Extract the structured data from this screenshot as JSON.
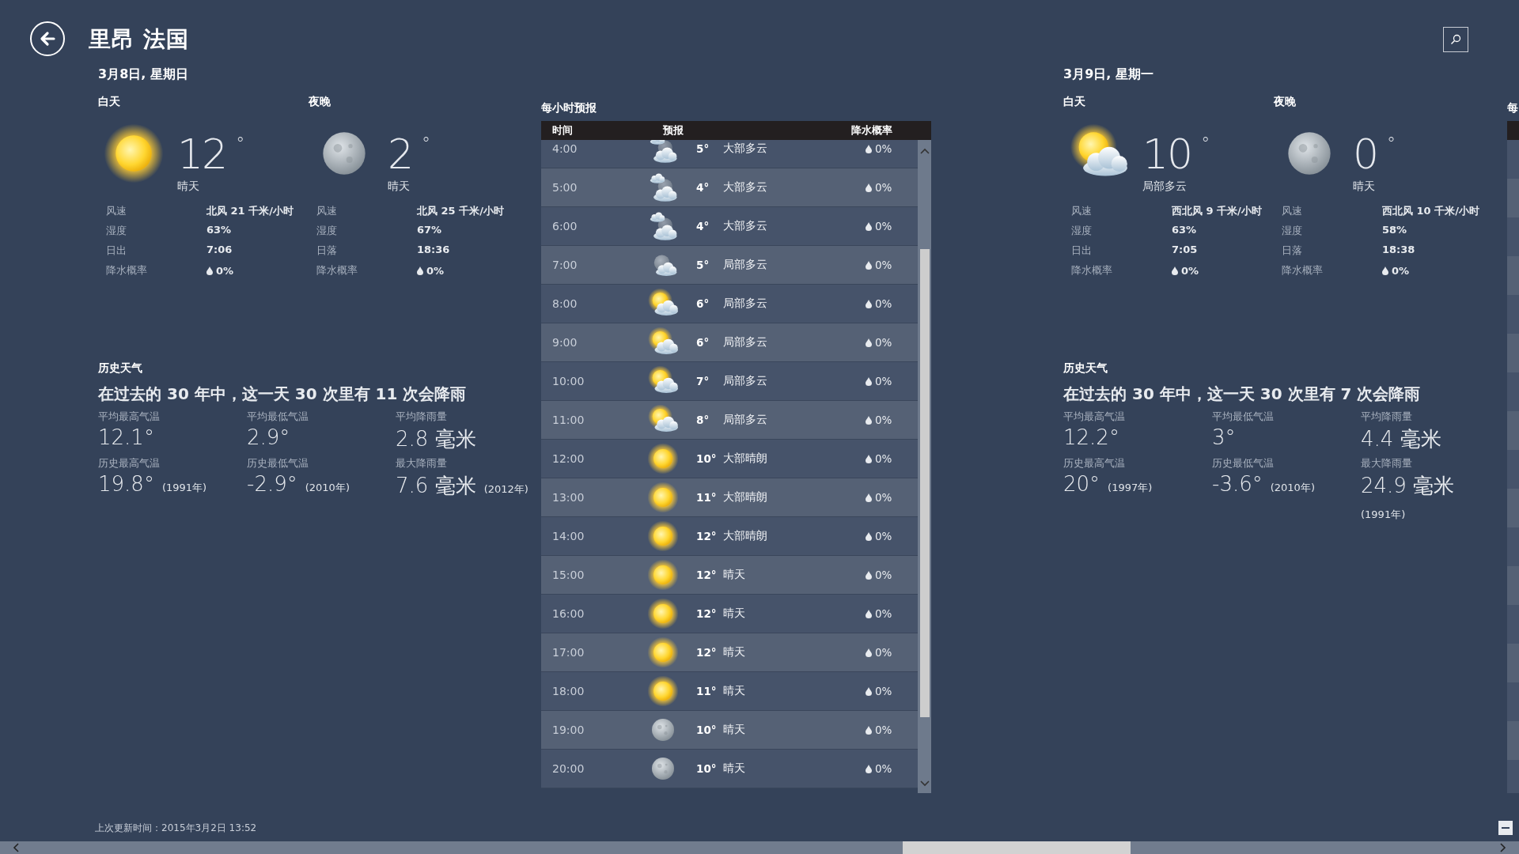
{
  "title": "里昂 法国",
  "days": [
    {
      "date": "3月8日, 星期日",
      "periods": [
        {
          "label": "白天",
          "kind": "sunny",
          "temp": "12$^{°}$",
          "condition": "晴天",
          "details": [
            {
              "label": "风速",
              "value": "北风 21 千米/小时",
              "kind": "text"
            },
            {
              "label": "湿度",
              "value": "63%",
              "kind": "text"
            },
            {
              "label": "日出",
              "value": "7:06",
              "kind": "text"
            },
            {
              "label": "降水概率",
              "value": "0%",
              "kind": "precip"
            }
          ]
        },
        {
          "label": "夜晚",
          "kind": "moon",
          "temp": "2$^{°}$",
          "condition": "晴天",
          "details": [
            {
              "label": "风速",
              "value": "北风 25 千米/小时",
              "kind": "text"
            },
            {
              "label": "湿度",
              "value": "67%",
              "kind": "text"
            },
            {
              "label": "日落",
              "value": "18:36",
              "kind": "text"
            },
            {
              "label": "降水概率",
              "value": "0%",
              "kind": "precip"
            }
          ]
        }
      ],
      "history": {
        "heading": "历史天气",
        "summary": "在过去的 30 年中，这一天 30 次里有 11 次会降雨",
        "stats": [
          {
            "label": "平均最高气温",
            "value": "12.1°"
          },
          {
            "label": "平均最低气温",
            "value": "2.9°"
          },
          {
            "label": "平均降雨量",
            "value": "2.8 毫米"
          },
          {
            "label": "历史最高气温",
            "value": "19.8°",
            "note": "(1991年)"
          },
          {
            "label": "历史最低气温",
            "value": "-2.9°",
            "note": "(2010年)"
          },
          {
            "label": "最大降雨量",
            "value": "7.6 毫米",
            "note": "(2012年)"
          }
        ]
      }
    },
    {
      "date": "3月9日, 星期一",
      "periods": [
        {
          "label": "白天",
          "kind": "partly-cloudy-day",
          "temp": "10$^{°}$",
          "condition": "局部多云",
          "details": [
            {
              "label": "风速",
              "value": "西北风 9 千米/小时",
              "kind": "text"
            },
            {
              "label": "湿度",
              "value": "63%",
              "kind": "text"
            },
            {
              "label": "日出",
              "value": "7:05",
              "kind": "text"
            },
            {
              "label": "降水概率",
              "value": "0%",
              "kind": "precip"
            }
          ]
        },
        {
          "label": "夜晚",
          "kind": "moon",
          "temp": "0$^{°}$",
          "condition": "晴天",
          "details": [
            {
              "label": "风速",
              "value": "西北风 10 千米/小时",
              "kind": "text"
            },
            {
              "label": "湿度",
              "value": "58%",
              "kind": "text"
            },
            {
              "label": "日落",
              "value": "18:38",
              "kind": "text"
            },
            {
              "label": "降水概率",
              "value": "0%",
              "kind": "precip"
            }
          ]
        }
      ],
      "history": {
        "heading": "历史天气",
        "summary": "在过去的 30 年中，这一天 30 次里有 7 次会降雨",
        "stats": [
          {
            "label": "平均最高气温",
            "value": "12.2°"
          },
          {
            "label": "平均最低气温",
            "value": "3°"
          },
          {
            "label": "平均降雨量",
            "value": "4.4 毫米"
          },
          {
            "label": "历史最高气温",
            "value": "20°",
            "note": "(1997年)"
          },
          {
            "label": "历史最低气温",
            "value": "-3.6°",
            "note": "(2010年)"
          },
          {
            "label": "最大降雨量",
            "value": "24.9 毫米",
            "note": "(1991年)"
          }
        ]
      }
    }
  ],
  "hourly": {
    "heading": "每小时预报",
    "columns": [
      "时间",
      "预报",
      "降水概率"
    ],
    "rows": [
      {
        "time": "4:00",
        "kind": "mostly-cloudy-night",
        "temp": "5°",
        "condition": "大部多云",
        "precip": "0%"
      },
      {
        "time": "5:00",
        "kind": "mostly-cloudy-night",
        "temp": "4°",
        "condition": "大部多云",
        "precip": "0%"
      },
      {
        "time": "6:00",
        "kind": "mostly-cloudy-night",
        "temp": "4°",
        "condition": "大部多云",
        "precip": "0%"
      },
      {
        "time": "7:00",
        "kind": "partly-cloudy-night",
        "temp": "5°",
        "condition": "局部多云",
        "precip": "0%"
      },
      {
        "time": "8:00",
        "kind": "partly-cloudy-day",
        "temp": "6°",
        "condition": "局部多云",
        "precip": "0%"
      },
      {
        "time": "9:00",
        "kind": "partly-cloudy-day",
        "temp": "6°",
        "condition": "局部多云",
        "precip": "0%"
      },
      {
        "time": "10:00",
        "kind": "partly-cloudy-day",
        "temp": "7°",
        "condition": "局部多云",
        "precip": "0%"
      },
      {
        "time": "11:00",
        "kind": "partly-cloudy-day",
        "temp": "8°",
        "condition": "局部多云",
        "precip": "0%"
      },
      {
        "time": "12:00",
        "kind": "sunny",
        "temp": "10°",
        "condition": "大部晴朗",
        "precip": "0%"
      },
      {
        "time": "13:00",
        "kind": "sunny",
        "temp": "11°",
        "condition": "大部晴朗",
        "precip": "0%"
      },
      {
        "time": "14:00",
        "kind": "sunny",
        "temp": "12°",
        "condition": "大部晴朗",
        "precip": "0%"
      },
      {
        "time": "15:00",
        "kind": "sunny",
        "temp": "12°",
        "condition": "晴天",
        "precip": "0%"
      },
      {
        "time": "16:00",
        "kind": "sunny",
        "temp": "12°",
        "condition": "晴天",
        "precip": "0%"
      },
      {
        "time": "17:00",
        "kind": "sunny",
        "temp": "12°",
        "condition": "晴天",
        "precip": "0%"
      },
      {
        "time": "18:00",
        "kind": "sunny",
        "temp": "11°",
        "condition": "晴天",
        "precip": "0%"
      },
      {
        "time": "19:00",
        "kind": "moon",
        "temp": "10°",
        "condition": "晴天",
        "precip": "0%"
      },
      {
        "time": "20:00",
        "kind": "moon",
        "temp": "10°",
        "condition": "晴天",
        "precip": "0%"
      }
    ]
  },
  "next_heading": "每",
  "last_updated": "上次更新时间：2015年3月2日 13:52"
}
